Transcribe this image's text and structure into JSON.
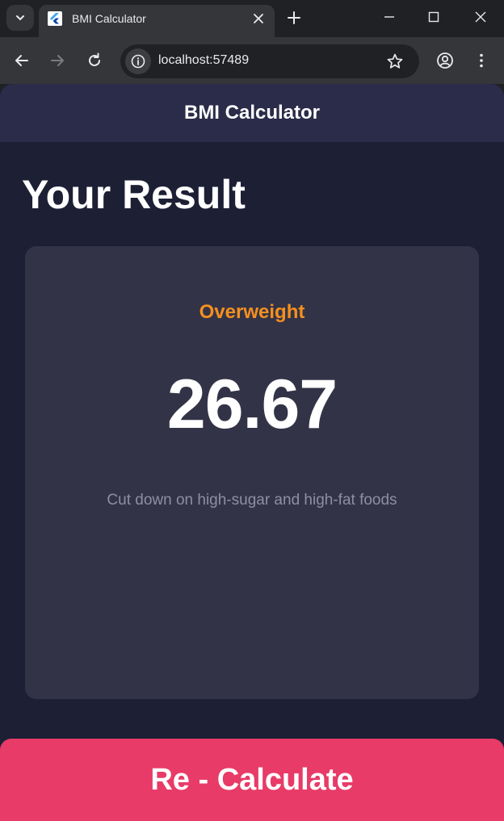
{
  "browser": {
    "tab_title": "BMI Calculator",
    "url": "localhost:57489"
  },
  "app": {
    "appbar_title": "BMI Calculator",
    "heading": "Your Result",
    "result": {
      "status": "Overweight",
      "bmi": "26.67",
      "advice": "Cut down on high-sugar and high-fat foods"
    },
    "recalculate_label": "Re - Calculate"
  },
  "colors": {
    "background": "#1d1f35",
    "appbar": "#2b2c4a",
    "card": "#333348",
    "status": "#f5901e",
    "button": "#e83b68"
  }
}
